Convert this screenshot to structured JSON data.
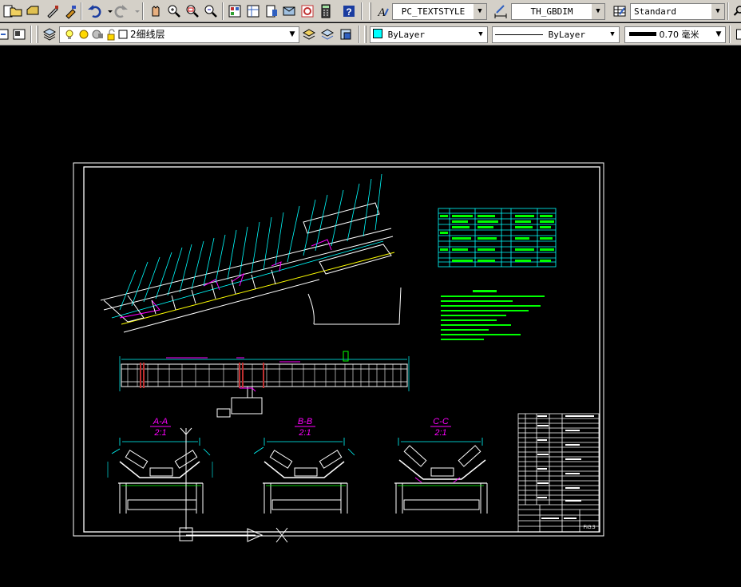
{
  "toolbar_top": {
    "text_style": "PC_TEXTSTYLE",
    "dim_style": "TH_GBDIM",
    "table_style": "Standard"
  },
  "toolbar_layers": {
    "current_layer": "2细线层",
    "color": "ByLayer",
    "linetype": "ByLayer",
    "lineweight": "0.70 毫米"
  },
  "drawing": {
    "section_labels": [
      "A-A",
      "B-B",
      "C-C"
    ],
    "section_scales": [
      "2:1",
      "2:1",
      "2:1"
    ],
    "title_block_text": "FIG.3"
  },
  "colors": {
    "toolbar_bg": "#d4d0c8",
    "canvas_bg": "#000000",
    "border": "#ffffff",
    "dims": "#00ffff",
    "notes": "#00ff00",
    "section_label": "#ff00ff"
  }
}
